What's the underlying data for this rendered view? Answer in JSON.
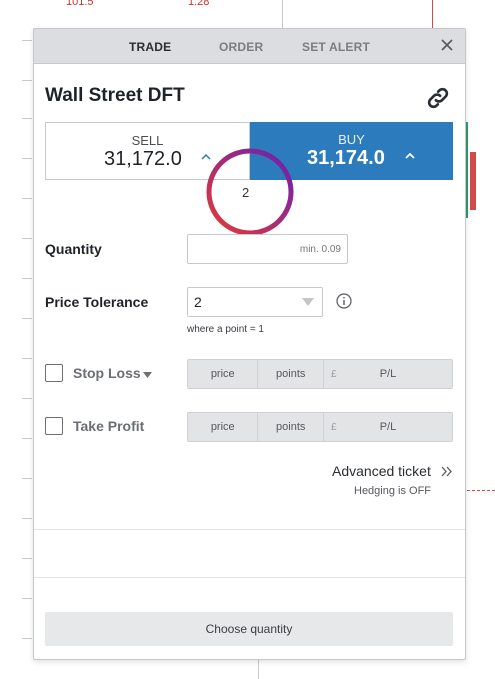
{
  "background": {
    "top_numbers": [
      "101.5",
      "1.28"
    ]
  },
  "tabs": [
    {
      "label": "TRADE",
      "active": true
    },
    {
      "label": "ORDER",
      "active": false
    },
    {
      "label": "SET ALERT",
      "active": false
    }
  ],
  "market": {
    "title": "Wall Street DFT"
  },
  "sell": {
    "label": "SELL",
    "price": "31,172.0"
  },
  "buy": {
    "label": "BUY",
    "price": "31,174.0"
  },
  "overlay": {
    "number": "2"
  },
  "quantity": {
    "label": "Quantity",
    "placeholder": "min. 0.09",
    "value": ""
  },
  "price_tolerance": {
    "label": "Price Tolerance",
    "value": "2",
    "hint": "where a point = 1"
  },
  "stop_loss": {
    "label": "Stop Loss",
    "checked": false,
    "price": "price",
    "points": "points",
    "currency": "£",
    "pl": "P/L"
  },
  "take_profit": {
    "label": "Take Profit",
    "checked": false,
    "price": "price",
    "points": "points",
    "currency": "£",
    "pl": "P/L"
  },
  "advanced": {
    "label": "Advanced ticket",
    "hedging": "Hedging is OFF"
  },
  "footer": {
    "choose_label": "Choose quantity"
  },
  "colors": {
    "buy": "#2b7bbd",
    "accent_ring_start": "#e53935",
    "accent_ring_end": "#6a1fb5"
  },
  "icons": [
    "close-icon",
    "link-icon",
    "chevron-up-icon",
    "chevron-down-icon",
    "info-icon",
    "double-chevron-right-icon"
  ]
}
